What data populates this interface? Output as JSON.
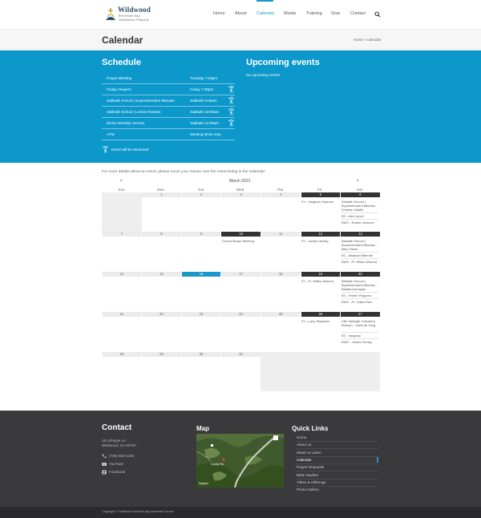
{
  "logo": {
    "name": "Wildwood",
    "line1": "Seventh-day",
    "line2": "Adventist Church"
  },
  "nav": {
    "items": [
      {
        "label": "Home",
        "active": false
      },
      {
        "label": "About",
        "active": false
      },
      {
        "label": "Calendar",
        "active": true
      },
      {
        "label": "Media",
        "active": false
      },
      {
        "label": "Training",
        "active": false
      },
      {
        "label": "Give",
        "active": false
      },
      {
        "label": "Contact",
        "active": false
      }
    ],
    "search_icon": "search-icon"
  },
  "page": {
    "title": "Calendar",
    "breadcrumb": "Home » Calendar"
  },
  "schedule": {
    "title": "Schedule",
    "rows": [
      {
        "name": "Prayer Meeting",
        "time": "Tuesday 7:00pm",
        "streamed": false
      },
      {
        "name": "Friday Vespers",
        "time": "Friday 7:00pm",
        "streamed": true
      },
      {
        "name": "Sabbath School | Superintendent Minutes",
        "time": "Sabbath 9:05am",
        "streamed": true
      },
      {
        "name": "Sabbath School | Lesson Review",
        "time": "Sabbath 10:00am",
        "streamed": true
      },
      {
        "name": "Divine Worship Service",
        "time": "Sabbath 11:00am",
        "streamed": true
      },
      {
        "name": "AYM",
        "time": "Meeting times vary",
        "streamed": false
      }
    ],
    "legend": "Event will be streamed"
  },
  "upcoming": {
    "title": "Upcoming events",
    "empty": "No upcoming events"
  },
  "calendar": {
    "note": "For more details about an event, please move your mouse over the event listing in the Calendar",
    "prev": "‹",
    "next": "›",
    "month": "March 2021",
    "days_of_week": [
      "Sun",
      "Mon",
      "Tue",
      "Wed",
      "Thu",
      "Fri",
      "Sat"
    ],
    "weeks": [
      {
        "days": [
          "",
          "1",
          "2",
          "3",
          "4",
          "5",
          "6"
        ],
        "events": {
          "5": [
            "Fri - Vaughan Sparrow"
          ],
          "6": [
            "Sabbath School | Superintendent Minutes - Cristina Castillo",
            "SS - Alex Lynch",
            "DWS - Robert Johnson"
          ]
        }
      },
      {
        "days": [
          "7",
          "8",
          "9",
          "10",
          "11",
          "12",
          "13"
        ],
        "events": {
          "10": [
            "Church Board Meeting"
          ],
          "12": [
            "Fri - James Henley"
          ],
          "13": [
            "Sabbath School | Superintendent Minutes - Mary Fisher",
            "SS - Mbabazi Mbende",
            "DWS - Pr. Wilbur Atwood"
          ]
        }
      },
      {
        "days": [
          "14",
          "15",
          "16",
          "17",
          "18",
          "19",
          "20"
        ],
        "events": {
          "19": [
            "Fri - Pr. Wilbur Atwood"
          ],
          "20": [
            "Sabbath School | Superintendent Minutes - Natalia Humayan",
            "SS - Yenten Reguero",
            "DWS - Pr. Julian Ruiz"
          ]
        }
      },
      {
        "days": [
          "21",
          "22",
          "23",
          "24",
          "25",
          "26",
          "27"
        ],
        "events": {
          "26": [
            "Fri - Larry Stapleton"
          ],
          "27": [
            "13th Sabbath Children's Division - Silvia de Jong",
            "SS - Vaughan",
            "DWS - James Henley"
          ]
        }
      },
      {
        "days": [
          "28",
          "29",
          "30",
          "31",
          "",
          "",
          ""
        ],
        "events": {}
      }
    ]
  },
  "footer": {
    "contact_title": "Contact",
    "address1": "18 Lifestyle Ln",
    "address2": "Wildwood, GA 30757",
    "phone": "(706) 820-1493",
    "youtube": "YouTube",
    "facebook": "Facebook",
    "map_title": "Map",
    "map_label": "Cooley Rd",
    "map_credit": "Mapbox",
    "links_title": "Quick Links",
    "links": [
      "Home",
      "About us",
      "Watch & Listen",
      "Calendar",
      "Prayer Requests",
      "Bible Studies",
      "Tithes & Offerings",
      "Photo Gallery"
    ]
  },
  "copyright": "Copyright © Wildwood Seventh-day Adventist Church",
  "colors": {
    "accent": "#0d98cb",
    "dark": "#333333",
    "footer": "#3a3a3c"
  }
}
